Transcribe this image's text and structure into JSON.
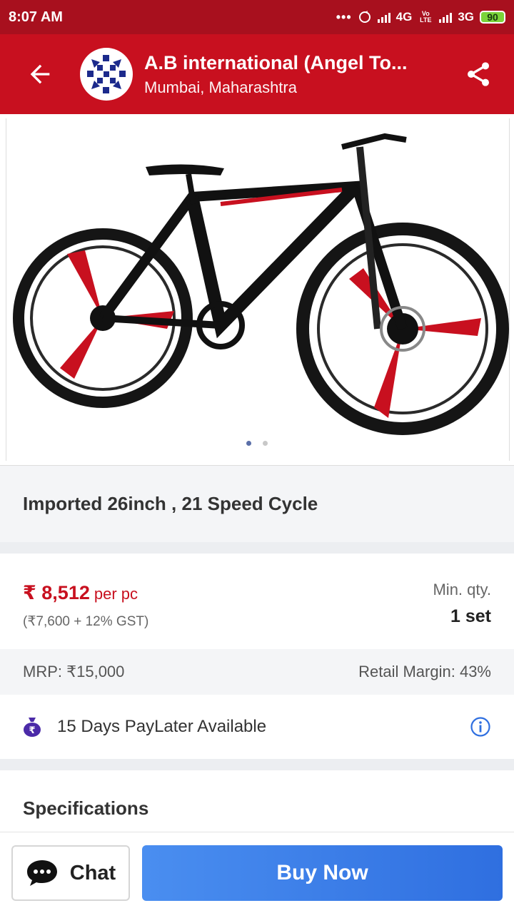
{
  "status_bar": {
    "time": "8:07 AM",
    "dots": "•••",
    "network_1": "4G",
    "volte": "Vo LTE",
    "network_2": "3G",
    "battery": "90"
  },
  "header": {
    "back_icon": "arrow-left-icon",
    "store_name": "A.B international (Angel To...",
    "store_location": "Mumbai, Maharashtra",
    "share_icon": "share-icon"
  },
  "product": {
    "title": "Imported 26inch , 21 Speed Cycle",
    "image_count": 2,
    "active_image": 0
  },
  "pricing": {
    "price": "₹ 8,512",
    "unit": "per pc",
    "breakdown": "(₹7,600 + 12% GST)",
    "min_qty_label": "Min. qty.",
    "min_qty_value": "1 set",
    "mrp": "MRP: ₹15,000",
    "retail_margin": "Retail Margin: 43%"
  },
  "paylater": {
    "icon": "money-bag-icon",
    "text": "15 Days PayLater Available",
    "info_icon": "info-icon"
  },
  "specifications": {
    "title": "Specifications"
  },
  "actions": {
    "chat_label": "Chat",
    "buy_label": "Buy Now"
  },
  "colors": {
    "primary_red": "#c8101f",
    "status_red": "#a8101e",
    "buy_blue": "#3a7cec"
  }
}
